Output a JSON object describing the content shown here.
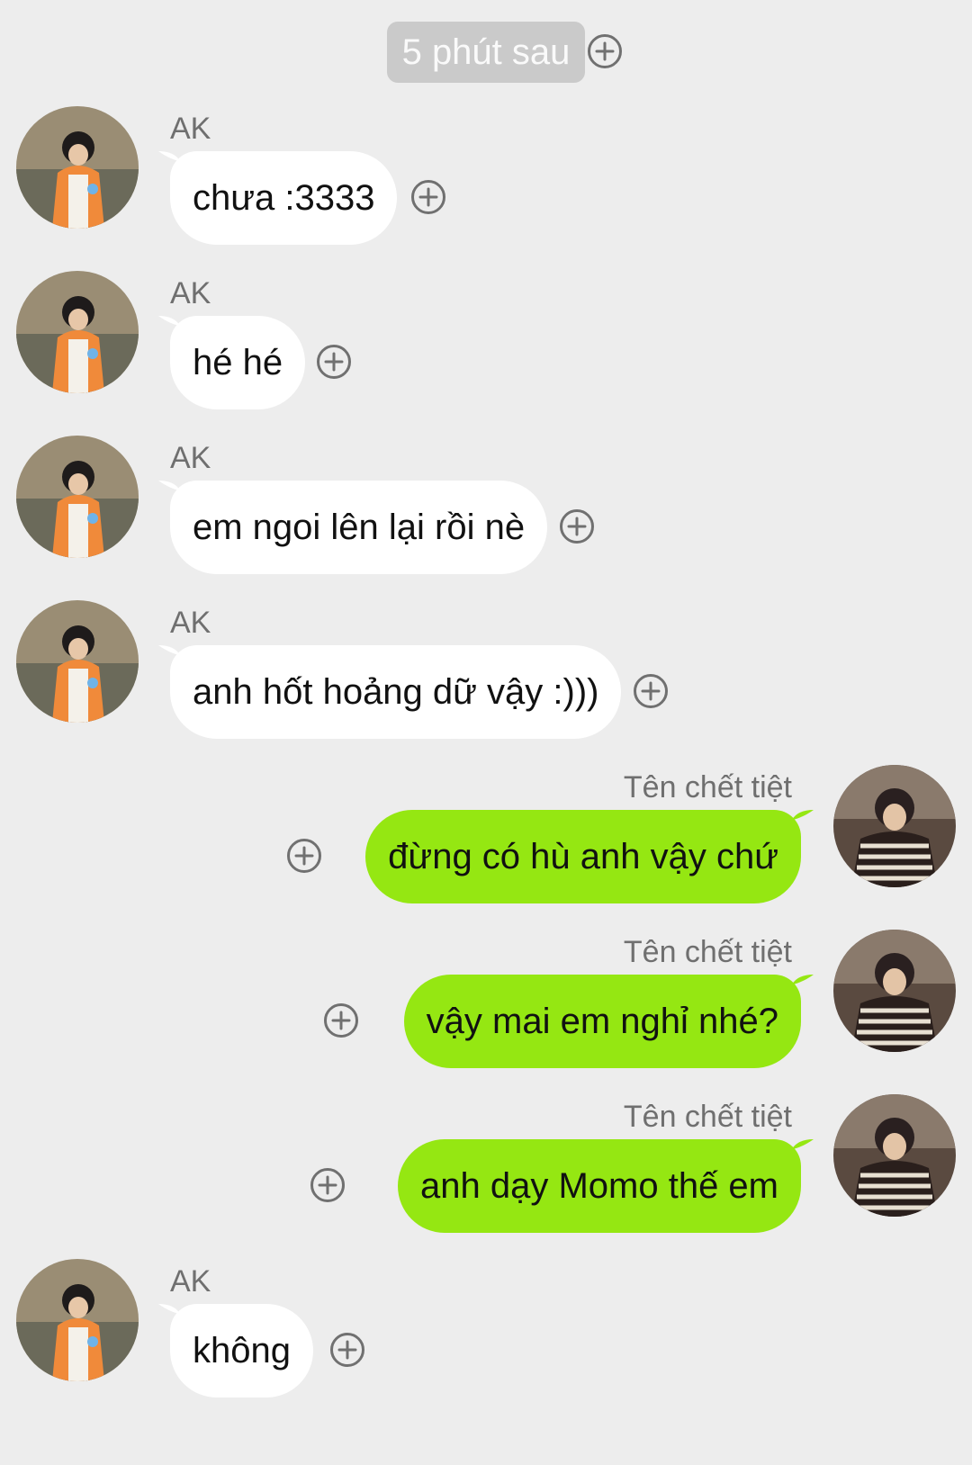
{
  "time_divider": {
    "label": "5 phút sau"
  },
  "colors": {
    "background": "#ededed",
    "incoming_bubble": "#ffffff",
    "outgoing_bubble": "#95e712",
    "time_pill": "#cacaca",
    "sender_text": "#6f6f6f",
    "plus_icon": "#707070"
  },
  "icons": {
    "react": "plus-circle-icon"
  },
  "messages": [
    {
      "direction": "in",
      "sender": "AK",
      "text": "chưa :3333"
    },
    {
      "direction": "in",
      "sender": "AK",
      "text": "hé hé"
    },
    {
      "direction": "in",
      "sender": "AK",
      "text": "em ngoi lên lại rồi nè"
    },
    {
      "direction": "in",
      "sender": "AK",
      "text": "anh hốt hoảng dữ vậy :)))"
    },
    {
      "direction": "out",
      "sender": "Tên chết tiệt",
      "text": "đừng có hù anh vậy chứ"
    },
    {
      "direction": "out",
      "sender": "Tên chết tiệt",
      "text": "vậy mai em nghỉ nhé?"
    },
    {
      "direction": "out",
      "sender": "Tên chết tiệt",
      "text": "anh dạy Momo thế em"
    },
    {
      "direction": "in",
      "sender": "AK",
      "text": "không"
    }
  ]
}
